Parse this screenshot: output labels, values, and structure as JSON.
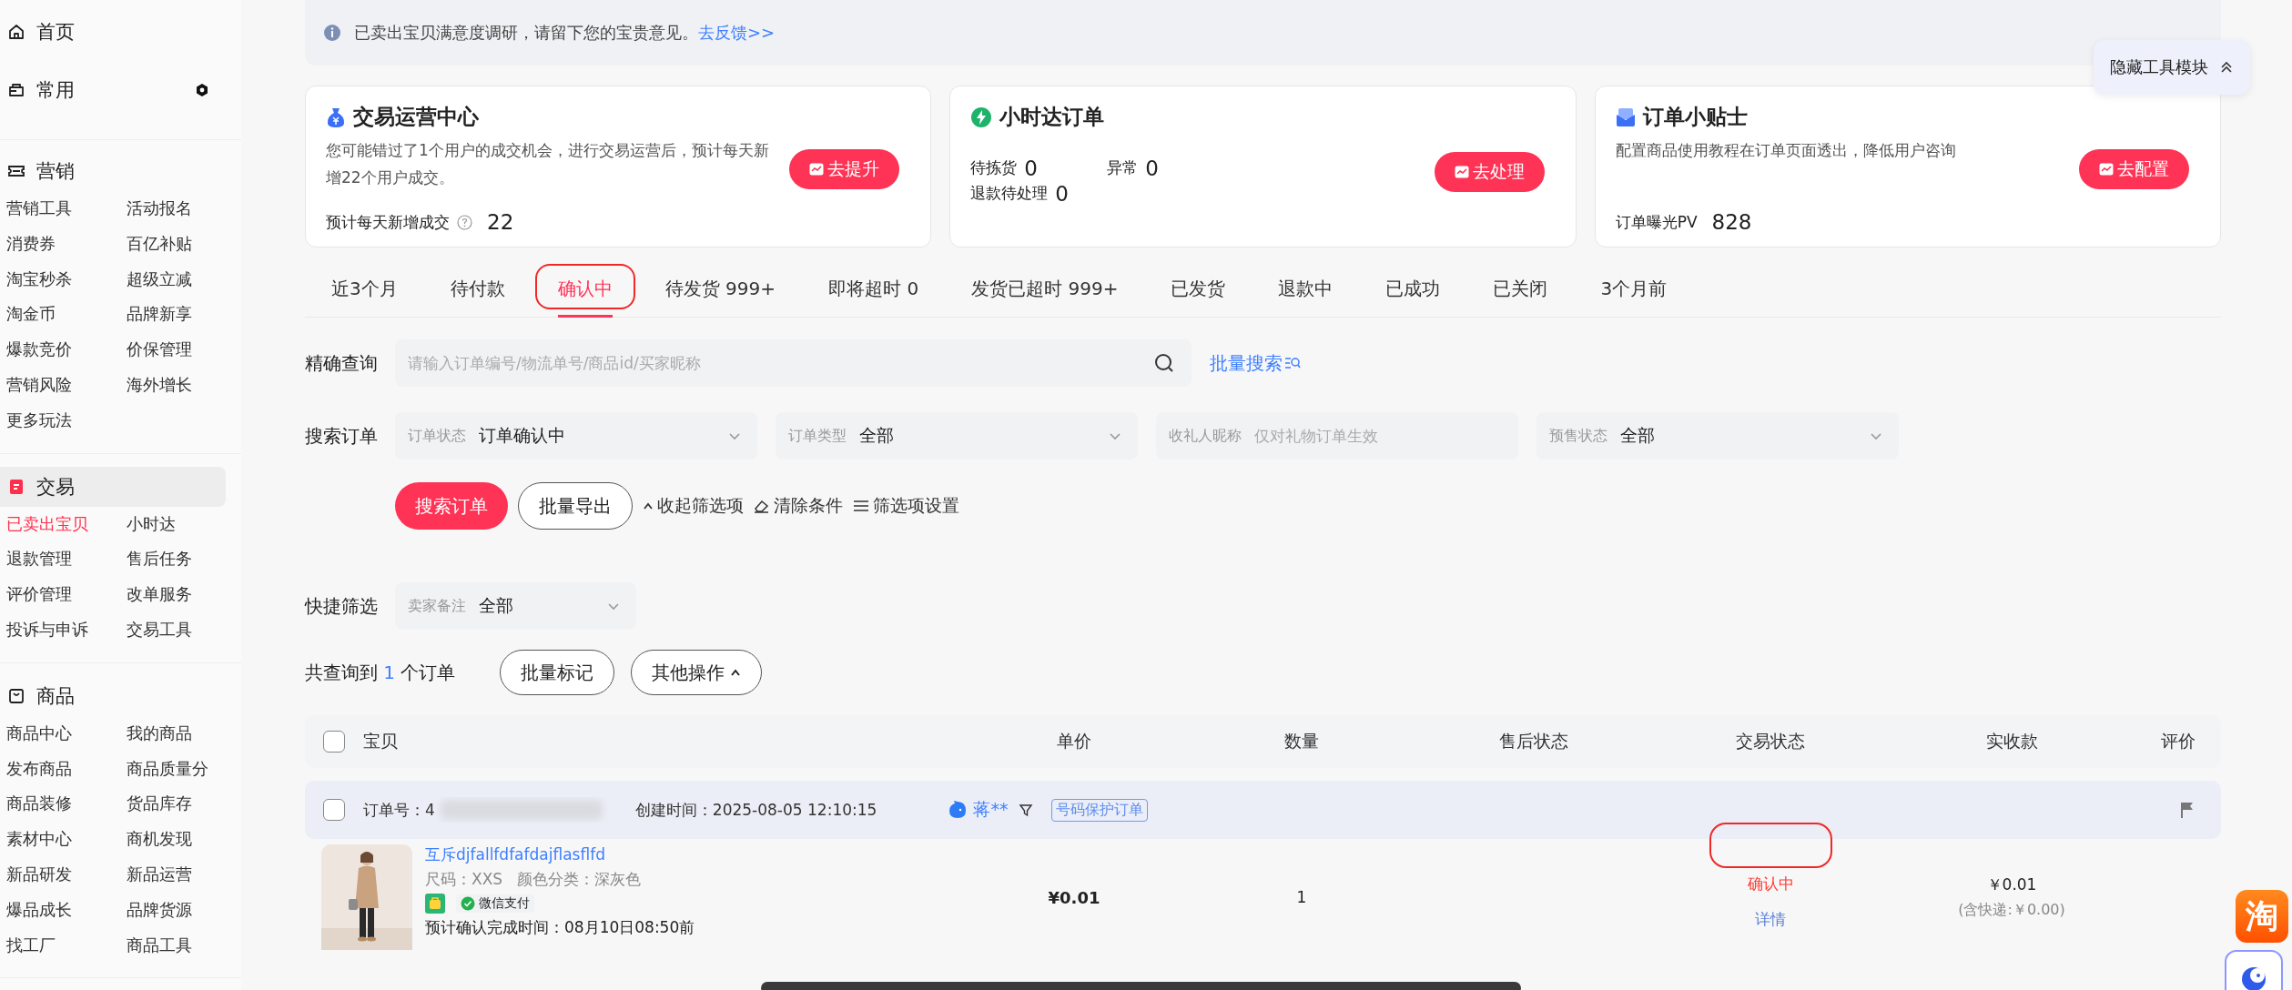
{
  "sidebar": {
    "top_items": [
      {
        "kind": "home",
        "label": "首页"
      },
      {
        "kind": "pinned",
        "label": "常用"
      }
    ],
    "sections": [
      {
        "kind": "marketing",
        "title": "营销",
        "selected": false,
        "items": [
          {
            "label": "营销工具",
            "selected": false
          },
          {
            "label": "活动报名",
            "selected": false
          },
          {
            "label": "消费券",
            "selected": false
          },
          {
            "label": "百亿补贴",
            "selected": false
          },
          {
            "label": "淘宝秒杀",
            "selected": false
          },
          {
            "label": "超级立减",
            "selected": false
          },
          {
            "label": "淘金币",
            "selected": false
          },
          {
            "label": "品牌新享",
            "selected": false
          },
          {
            "label": "爆款竞价",
            "selected": false
          },
          {
            "label": "价保管理",
            "selected": false
          },
          {
            "label": "营销风险",
            "selected": false
          },
          {
            "label": "海外增长",
            "selected": false
          },
          {
            "label": "更多玩法",
            "selected": false
          }
        ]
      },
      {
        "kind": "trade",
        "title": "交易",
        "selected": true,
        "items": [
          {
            "label": "已卖出宝贝",
            "selected": true
          },
          {
            "label": "小时达",
            "selected": false
          },
          {
            "label": "退款管理",
            "selected": false
          },
          {
            "label": "售后任务",
            "selected": false
          },
          {
            "label": "评价管理",
            "selected": false
          },
          {
            "label": "改单服务",
            "selected": false
          },
          {
            "label": "投诉与申诉",
            "selected": false
          },
          {
            "label": "交易工具",
            "selected": false
          }
        ]
      },
      {
        "kind": "goods",
        "title": "商品",
        "selected": false,
        "items": [
          {
            "label": "商品中心",
            "selected": false
          },
          {
            "label": "我的商品",
            "selected": false
          },
          {
            "label": "发布商品",
            "selected": false
          },
          {
            "label": "商品质量分",
            "selected": false
          },
          {
            "label": "商品装修",
            "selected": false
          },
          {
            "label": "货品库存",
            "selected": false
          },
          {
            "label": "素材中心",
            "selected": false
          },
          {
            "label": "商机发现",
            "selected": false
          },
          {
            "label": "新品研发",
            "selected": false
          },
          {
            "label": "新品运营",
            "selected": false
          },
          {
            "label": "爆品成长",
            "selected": false
          },
          {
            "label": "品牌货源",
            "selected": false
          },
          {
            "label": "找工厂",
            "selected": false
          },
          {
            "label": "商品工具",
            "selected": false
          }
        ]
      }
    ]
  },
  "notice": {
    "text": "已卖出宝贝满意度调研，请留下您的宝贵意见。",
    "link": "去反馈>>"
  },
  "tool_toggle": "隐藏工具模块",
  "cards": [
    {
      "kind": "ops",
      "title": "交易运营中心",
      "description": "您可能错过了1个用户的成交机会，进行交易运营后，预计每天新增22个用户成交。",
      "button": "去提升",
      "stats": [
        {
          "label": "预计每天新增成交",
          "value": "22"
        }
      ]
    },
    {
      "kind": "hourly",
      "title": "小时达订单",
      "button": "去处理",
      "stats": [
        {
          "label": "待拣货",
          "value": "0"
        },
        {
          "label": "异常",
          "value": "0"
        },
        {
          "label": "退款待处理",
          "value": "0"
        }
      ]
    },
    {
      "kind": "tips",
      "title": "订单小贴士",
      "description": "配置商品使用教程在订单页面透出，降低用户咨询",
      "button": "去配置",
      "stats": [
        {
          "label": "订单曝光PV",
          "value": "828"
        }
      ]
    }
  ],
  "tabs": [
    {
      "label": "近3个月",
      "selected": false
    },
    {
      "label": "待付款",
      "selected": false
    },
    {
      "label": "确认中",
      "selected": true
    },
    {
      "label": "待发货 999+",
      "selected": false
    },
    {
      "label": "即将超时 0",
      "selected": false
    },
    {
      "label": "发货已超时 999+",
      "selected": false
    },
    {
      "label": "已发货",
      "selected": false
    },
    {
      "label": "退款中",
      "selected": false
    },
    {
      "label": "已成功",
      "selected": false
    },
    {
      "label": "已关闭",
      "selected": false
    },
    {
      "label": "3个月前",
      "selected": false
    }
  ],
  "search": {
    "label": "精确查询",
    "placeholder": "请输入订单编号/物流单号/商品id/买家昵称",
    "batch_link": "批量搜索"
  },
  "filters": {
    "label": "搜索订单",
    "fields": [
      {
        "kind": "select",
        "label": "订单状态",
        "value": "订单确认中"
      },
      {
        "kind": "select",
        "label": "订单类型",
        "value": "全部"
      },
      {
        "kind": "input",
        "label": "收礼人昵称",
        "placeholder": "仅对礼物订单生效"
      },
      {
        "kind": "select",
        "label": "预售状态",
        "value": "全部"
      }
    ]
  },
  "actions": {
    "primary": "搜索订单",
    "secondary": "批量导出",
    "links": [
      {
        "kind": "collapse",
        "label": "收起筛选项"
      },
      {
        "kind": "clear",
        "label": "清除条件"
      },
      {
        "kind": "settings",
        "label": "筛选项设置"
      }
    ]
  },
  "quick_filter": {
    "label": "快捷筛选",
    "field": {
      "label": "卖家备注",
      "value": "全部"
    }
  },
  "results": {
    "prefix": "共查询到",
    "count": "1",
    "suffix": "个订单",
    "buttons": [
      {
        "kind": "plain",
        "label": "批量标记"
      },
      {
        "kind": "menu",
        "label": "其他操作"
      }
    ]
  },
  "table": {
    "all_checked": false,
    "columns": [
      "宝贝",
      "单价",
      "数量",
      "售后状态",
      "交易状态",
      "实收款",
      "评价"
    ],
    "orders": [
      {
        "checked": false,
        "order_no": "订单号：4",
        "created": "创建时间：2025-08-05 12:10:15",
        "buyer": "蒋**",
        "tag": "号码保护订单",
        "item": {
          "title": "互斥djfallfdfafdajflasflfd",
          "sku": "尺码：XXS   颜色分类：深灰色",
          "payment": "微信支付",
          "estimate": "预计确认完成时间：08月10日08:50前",
          "price": "¥0.01",
          "quantity": "1",
          "status": "确认中",
          "detail": "详情",
          "received": "￥0.01",
          "shipping": "(含快递:￥0.00)"
        }
      }
    ]
  },
  "floating_badge": "淘"
}
